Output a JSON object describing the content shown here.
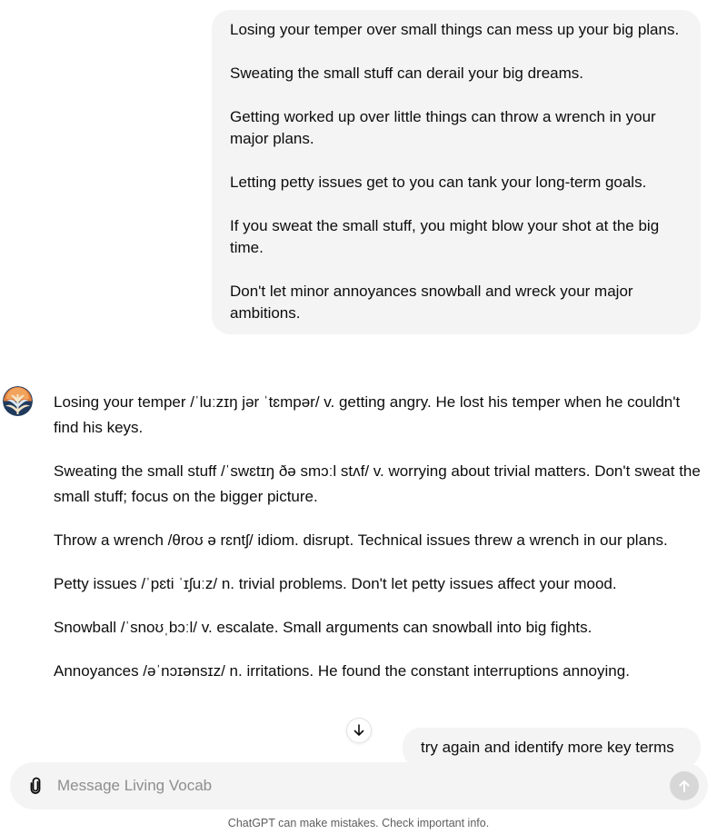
{
  "user_message": {
    "paragraphs": [
      "Losing your temper over small things can mess up your big plans.",
      "Sweating the small stuff can derail your big dreams.",
      "Getting worked up over little things can throw a wrench in your major plans.",
      "Letting petty issues get to you can tank your long-term goals.",
      "If you sweat the small stuff, you might blow your shot at the big time.",
      "Don't let minor annoyances snowball and wreck your major ambitions."
    ]
  },
  "assistant_message": {
    "avatar_icon": "living-vocab-avatar-icon",
    "paragraphs": [
      "Losing your temper /ˈluːzɪŋ jər ˈtɛmpər/ v. getting angry. He lost his temper when he couldn't find his keys.",
      "Sweating the small stuff /ˈswɛtɪŋ ðə smɔːl stʌf/ v. worrying about trivial matters. Don't sweat the small stuff; focus on the bigger picture.",
      "Throw a wrench /θroʊ ə rɛntʃ/ idiom. disrupt. Technical issues threw a wrench in our plans.",
      "Petty issues /ˈpɛti ˈɪʃuːz/ n. trivial problems. Don't let petty issues affect your mood.",
      "Snowball /ˈsnoʊˌbɔːl/ v. escalate. Small arguments can snowball into big fights.",
      "Annoyances /əˈnɔɪənsɪz/ n. irritations. He found the constant interruptions annoying."
    ]
  },
  "pending_user_message": "try again and identify more key terms",
  "scroll_icon": "arrow-down-icon",
  "composer": {
    "placeholder": "Message Living Vocab",
    "attach_icon": "paperclip-icon",
    "send_icon": "arrow-up-icon"
  },
  "disclaimer": "ChatGPT can make mistakes. Check important info.",
  "colors": {
    "bubble_bg": "#f4f4f4",
    "text": "#0d0d0d",
    "placeholder": "#8e8e8e",
    "send_disabled": "#d7d7d7"
  }
}
